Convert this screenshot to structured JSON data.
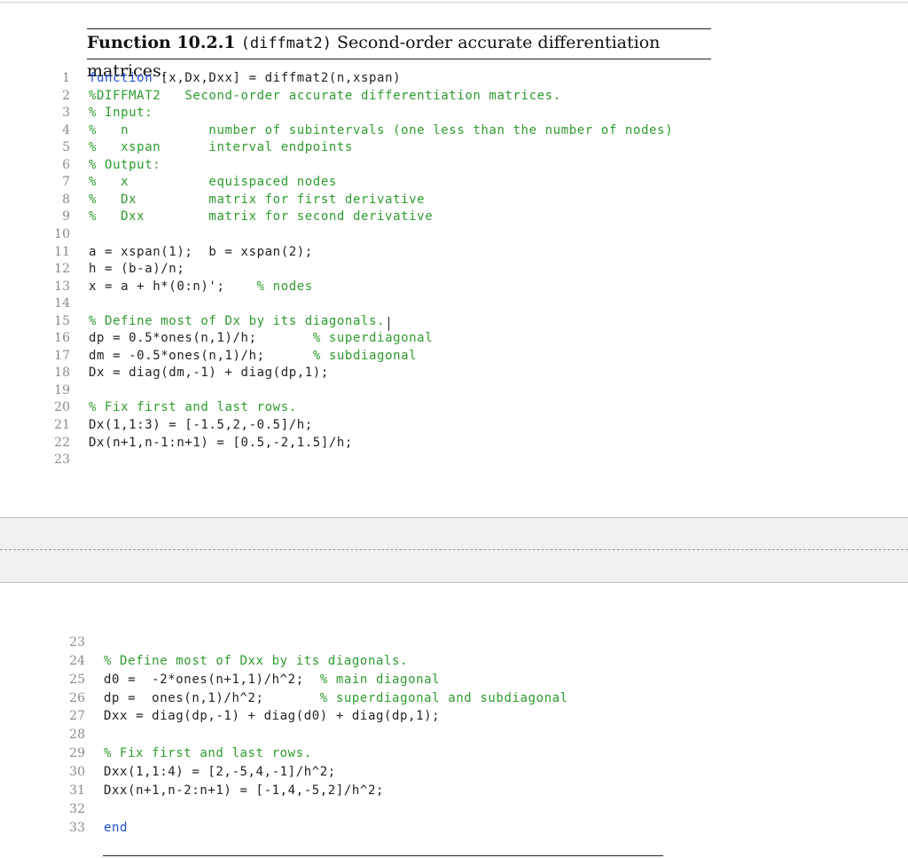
{
  "caption": {
    "label": "Function 10.2.1",
    "fn": "(diffmat2)",
    "title": "Second-order accurate differentiation matrices."
  },
  "code_top": [
    {
      "n": "1",
      "segs": [
        {
          "t": "function",
          "c": "kw"
        },
        {
          "t": " [x,Dx,Dxx] = diffmat2(n,xspan)",
          "c": ""
        }
      ]
    },
    {
      "n": "2",
      "segs": [
        {
          "t": "%DIFFMAT2   Second-order accurate differentiation matrices.",
          "c": "cm"
        }
      ]
    },
    {
      "n": "3",
      "segs": [
        {
          "t": "% Input:",
          "c": "cm"
        }
      ]
    },
    {
      "n": "4",
      "segs": [
        {
          "t": "%   n          number of subintervals (one less than the number of nodes)",
          "c": "cm"
        }
      ]
    },
    {
      "n": "5",
      "segs": [
        {
          "t": "%   xspan      interval endpoints",
          "c": "cm"
        }
      ]
    },
    {
      "n": "6",
      "segs": [
        {
          "t": "% Output:",
          "c": "cm"
        }
      ]
    },
    {
      "n": "7",
      "segs": [
        {
          "t": "%   x          equispaced nodes",
          "c": "cm"
        }
      ]
    },
    {
      "n": "8",
      "segs": [
        {
          "t": "%   Dx         matrix for first derivative",
          "c": "cm"
        }
      ]
    },
    {
      "n": "9",
      "segs": [
        {
          "t": "%   Dxx        matrix for second derivative",
          "c": "cm"
        }
      ]
    },
    {
      "n": "10",
      "segs": []
    },
    {
      "n": "11",
      "segs": [
        {
          "t": "a = xspan(1);  b = xspan(2);",
          "c": ""
        }
      ]
    },
    {
      "n": "12",
      "segs": [
        {
          "t": "h = (b-a)/n;",
          "c": ""
        }
      ]
    },
    {
      "n": "13",
      "segs": [
        {
          "t": "x = a + h*(0:n)';    ",
          "c": ""
        },
        {
          "t": "% nodes",
          "c": "cm"
        }
      ]
    },
    {
      "n": "14",
      "segs": []
    },
    {
      "n": "15",
      "segs": [
        {
          "t": "% Define most of Dx by its diagonals.",
          "c": "cm"
        }
      ]
    },
    {
      "n": "16",
      "segs": [
        {
          "t": "dp = 0.5*ones(n,1)/h;       ",
          "c": ""
        },
        {
          "t": "% superdiagonal",
          "c": "cm"
        }
      ]
    },
    {
      "n": "17",
      "segs": [
        {
          "t": "dm = -0.5*ones(n,1)/h;      ",
          "c": ""
        },
        {
          "t": "% subdiagonal",
          "c": "cm"
        }
      ]
    },
    {
      "n": "18",
      "segs": [
        {
          "t": "Dx = diag(dm,-1) + diag(dp,1);",
          "c": ""
        }
      ]
    },
    {
      "n": "19",
      "segs": []
    },
    {
      "n": "20",
      "segs": [
        {
          "t": "% Fix first and last rows.",
          "c": "cm"
        }
      ]
    },
    {
      "n": "21",
      "segs": [
        {
          "t": "Dx(1,1:3) = [-1.5,2,-0.5]/h;",
          "c": ""
        }
      ]
    },
    {
      "n": "22",
      "segs": [
        {
          "t": "Dx(n+1,n-1:n+1) = [0.5,-2,1.5]/h;",
          "c": ""
        }
      ]
    },
    {
      "n": "23",
      "segs": []
    }
  ],
  "code_bottom": [
    {
      "n": "23",
      "segs": []
    },
    {
      "n": "24",
      "segs": [
        {
          "t": "% Define most of Dxx by its diagonals.",
          "c": "cm"
        }
      ]
    },
    {
      "n": "25",
      "segs": [
        {
          "t": "d0 =  -2*ones(n+1,1)/h^2;  ",
          "c": ""
        },
        {
          "t": "% main diagonal",
          "c": "cm"
        }
      ]
    },
    {
      "n": "26",
      "segs": [
        {
          "t": "dp =  ones(n,1)/h^2;       ",
          "c": ""
        },
        {
          "t": "% superdiagonal and subdiagonal",
          "c": "cm"
        }
      ]
    },
    {
      "n": "27",
      "segs": [
        {
          "t": "Dxx = diag(dp,-1) + diag(d0) + diag(dp,1);",
          "c": ""
        }
      ]
    },
    {
      "n": "28",
      "segs": []
    },
    {
      "n": "29",
      "segs": [
        {
          "t": "% Fix first and last rows.",
          "c": "cm"
        }
      ]
    },
    {
      "n": "30",
      "segs": [
        {
          "t": "Dxx(1,1:4) = [2,-5,4,-1]/h^2;",
          "c": ""
        }
      ]
    },
    {
      "n": "31",
      "segs": [
        {
          "t": "Dxx(n+1,n-2:n+1) = [-1,4,-5,2]/h^2;",
          "c": ""
        }
      ]
    },
    {
      "n": "32",
      "segs": []
    },
    {
      "n": "33",
      "segs": [
        {
          "t": "end",
          "c": "kw"
        }
      ]
    }
  ]
}
